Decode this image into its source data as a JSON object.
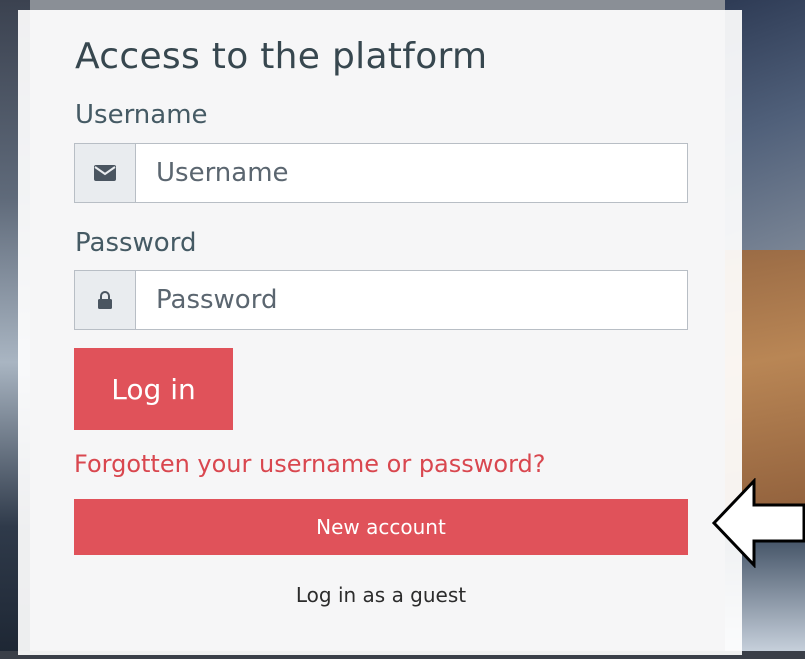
{
  "login": {
    "title": "Access to the platform",
    "username_label": "Username",
    "username_placeholder": "Username",
    "password_label": "Password",
    "password_placeholder": "Password",
    "login_button": "Log in",
    "forgot_link": "Forgotten your username or password?",
    "new_account_button": "New account",
    "guest_link": "Log in as a guest"
  },
  "icons": {
    "username": "envelope-icon",
    "password": "lock-icon",
    "annotation": "left-arrow-icon"
  },
  "colors": {
    "accent": "#e0525a",
    "link": "#d9474f",
    "text": "#455a64"
  }
}
